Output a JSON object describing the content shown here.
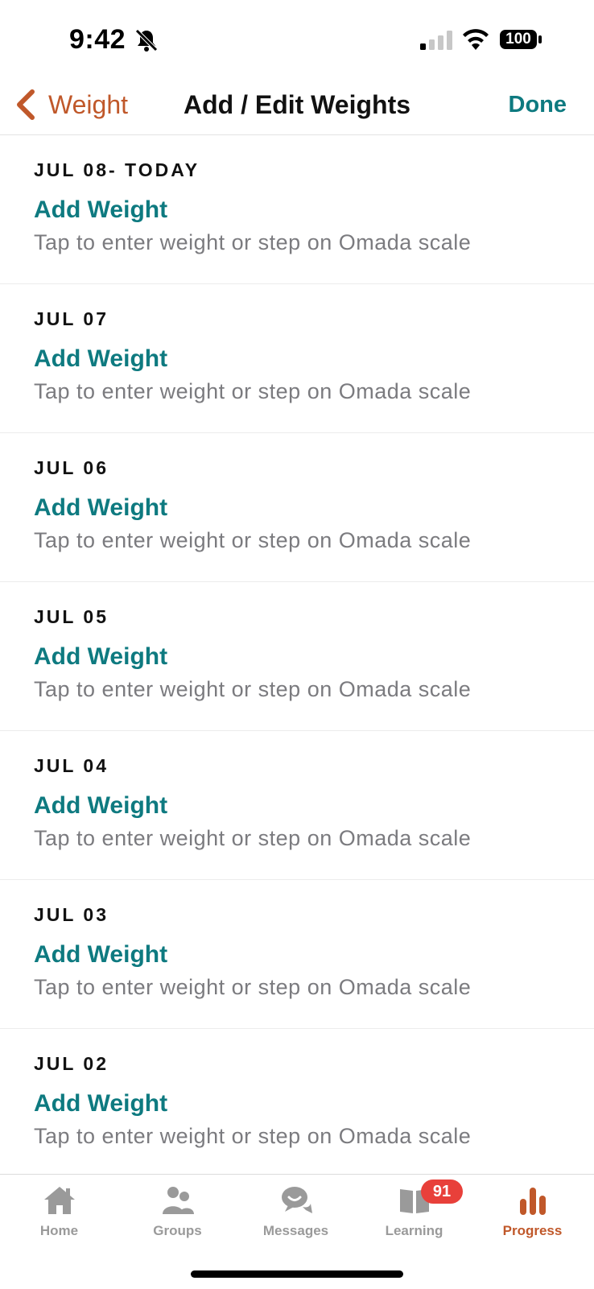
{
  "status": {
    "time": "9:42",
    "battery": "100"
  },
  "nav": {
    "back_label": "Weight",
    "title": "Add / Edit Weights",
    "done_label": "Done"
  },
  "entries": [
    {
      "date": "JUL 08- TODAY",
      "action": "Add Weight",
      "hint": "Tap to enter weight or step on Omada scale"
    },
    {
      "date": "JUL 07",
      "action": "Add Weight",
      "hint": "Tap to enter weight or step on Omada scale"
    },
    {
      "date": "JUL 06",
      "action": "Add Weight",
      "hint": "Tap to enter weight or step on Omada scale"
    },
    {
      "date": "JUL 05",
      "action": "Add Weight",
      "hint": "Tap to enter weight or step on Omada scale"
    },
    {
      "date": "JUL 04",
      "action": "Add Weight",
      "hint": "Tap to enter weight or step on Omada scale"
    },
    {
      "date": "JUL 03",
      "action": "Add Weight",
      "hint": "Tap to enter weight or step on Omada scale"
    },
    {
      "date": "JUL 02",
      "action": "Add Weight",
      "hint": "Tap to enter weight or step on Omada scale"
    }
  ],
  "tabs": [
    {
      "label": "Home",
      "icon": "home-icon"
    },
    {
      "label": "Groups",
      "icon": "groups-icon"
    },
    {
      "label": "Messages",
      "icon": "messages-icon"
    },
    {
      "label": "Learning",
      "icon": "book-icon",
      "badge": "91"
    },
    {
      "label": "Progress",
      "icon": "bar-chart-icon",
      "active": true
    }
  ],
  "colors": {
    "accent": "#c0582a",
    "link": "#0e7a80",
    "badge": "#e8403a",
    "muted": "#7b7b7f"
  }
}
